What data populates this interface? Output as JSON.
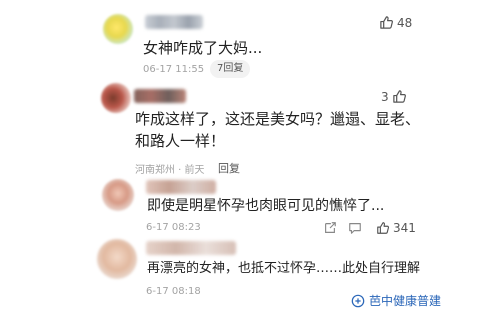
{
  "comments": [
    {
      "text": "女神咋成了大妈...",
      "date": "06-17 11:55",
      "reply": "7回复",
      "likes": "48"
    },
    {
      "lines": [
        "咋成这样了，这还是美女吗？邋遢、显老、",
        "和路人一样！"
      ],
      "location": "河南郑州 · 前天",
      "reply": "回复",
      "likes": "3"
    },
    {
      "text": "即使是明星怀孕也肉眼可见的憔悴了...",
      "date": "6-17 08:23",
      "likes": "341"
    },
    {
      "text": "再漂亮的女神，也抵不过怀孕……此处自行理解",
      "date": "6-17 08:18"
    }
  ],
  "watermark": "芭中健康普建",
  "colors": {
    "text": "#222222",
    "meta": "#a3a3a3",
    "watermark": "#2a66b8"
  }
}
